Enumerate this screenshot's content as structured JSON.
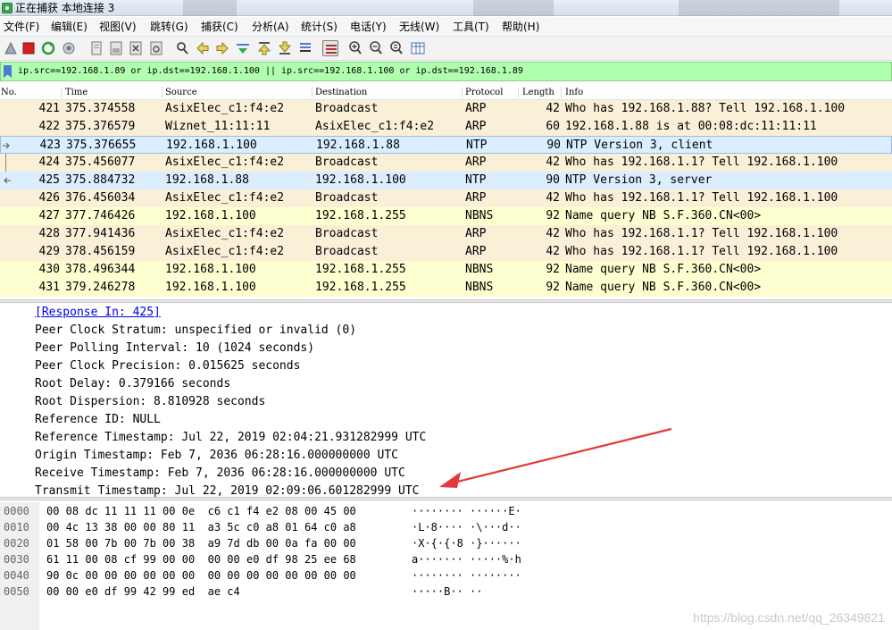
{
  "window": {
    "title": "正在捕获 本地连接 3"
  },
  "menu": [
    "文件(F)",
    "编辑(E)",
    "视图(V)",
    "跳转(G)",
    "捕获(C)",
    "分析(A)",
    "统计(S)",
    "电话(Y)",
    "无线(W)",
    "工具(T)",
    "帮助(H)"
  ],
  "toolbar": {
    "icons": [
      "shark-fin-icon",
      "stop-capture-icon",
      "restart-capture-icon",
      "capture-options-icon",
      "open-file-icon",
      "save-file-icon",
      "close-file-icon",
      "reload-file-icon",
      "find-packet-icon",
      "go-back-icon",
      "go-forward-icon",
      "go-to-packet-icon",
      "go-first-icon",
      "go-last-icon",
      "auto-scroll-icon",
      "colorize-icon",
      "zoom-in-icon",
      "zoom-out-icon",
      "zoom-normal-icon",
      "resize-columns-icon"
    ]
  },
  "filter": {
    "text": "ip.src==192.168.1.89 or ip.dst==192.168.1.100 || ip.src==192.168.1.100 or ip.dst==192.168.1.89"
  },
  "packet_list": {
    "columns": [
      "No.",
      "Time",
      "Source",
      "Destination",
      "Protocol",
      "Length",
      "Info"
    ],
    "rows": [
      {
        "no": "421",
        "time": "375.374558",
        "src": "AsixElec_c1:f4:e2",
        "dst": "Broadcast",
        "proto": "ARP",
        "len": "42",
        "info": "Who has 192.168.1.88? Tell 192.168.1.100"
      },
      {
        "no": "422",
        "time": "375.376579",
        "src": "Wiznet_11:11:11",
        "dst": "AsixElec_c1:f4:e2",
        "proto": "ARP",
        "len": "60",
        "info": "192.168.1.88 is at 00:08:dc:11:11:11"
      },
      {
        "no": "423",
        "time": "375.376655",
        "src": "192.168.1.100",
        "dst": "192.168.1.88",
        "proto": "NTP",
        "len": "90",
        "info": "NTP Version 3, client"
      },
      {
        "no": "424",
        "time": "375.456077",
        "src": "AsixElec_c1:f4:e2",
        "dst": "Broadcast",
        "proto": "ARP",
        "len": "42",
        "info": "Who has 192.168.1.1? Tell 192.168.1.100"
      },
      {
        "no": "425",
        "time": "375.884732",
        "src": "192.168.1.88",
        "dst": "192.168.1.100",
        "proto": "NTP",
        "len": "90",
        "info": "NTP Version 3, server"
      },
      {
        "no": "426",
        "time": "376.456034",
        "src": "AsixElec_c1:f4:e2",
        "dst": "Broadcast",
        "proto": "ARP",
        "len": "42",
        "info": "Who has 192.168.1.1? Tell 192.168.1.100"
      },
      {
        "no": "427",
        "time": "377.746426",
        "src": "192.168.1.100",
        "dst": "192.168.1.255",
        "proto": "NBNS",
        "len": "92",
        "info": "Name query NB S.F.360.CN<00>"
      },
      {
        "no": "428",
        "time": "377.941436",
        "src": "AsixElec_c1:f4:e2",
        "dst": "Broadcast",
        "proto": "ARP",
        "len": "42",
        "info": "Who has 192.168.1.1? Tell 192.168.1.100"
      },
      {
        "no": "429",
        "time": "378.456159",
        "src": "AsixElec_c1:f4:e2",
        "dst": "Broadcast",
        "proto": "ARP",
        "len": "42",
        "info": "Who has 192.168.1.1? Tell 192.168.1.100"
      },
      {
        "no": "430",
        "time": "378.496344",
        "src": "192.168.1.100",
        "dst": "192.168.1.255",
        "proto": "NBNS",
        "len": "92",
        "info": "Name query NB S.F.360.CN<00>"
      },
      {
        "no": "431",
        "time": "379.246278",
        "src": "192.168.1.100",
        "dst": "192.168.1.255",
        "proto": "NBNS",
        "len": "92",
        "info": "Name query NB S.F.360.CN<00>"
      }
    ]
  },
  "details": {
    "lines": [
      "[Response In: 425]",
      "Peer Clock Stratum: unspecified or invalid (0)",
      "Peer Polling Interval: 10 (1024 seconds)",
      "Peer Clock Precision: 0.015625 seconds",
      "Root Delay: 0.379166 seconds",
      "Root Dispersion: 8.810928 seconds",
      "Reference ID: NULL",
      "Reference Timestamp: Jul 22, 2019 02:04:21.931282999 UTC",
      "Origin Timestamp: Feb  7, 2036 06:28:16.000000000 UTC",
      "Receive Timestamp: Feb  7, 2036 06:28:16.000000000 UTC",
      "Transmit Timestamp: Jul 22, 2019 02:09:06.601282999 UTC"
    ]
  },
  "bytes": {
    "rows": [
      {
        "off": "0000",
        "hex": "00 08 dc 11 11 11 00 0e  c6 c1 f4 e2 08 00 45 00",
        "ascii": "········ ······E·"
      },
      {
        "off": "0010",
        "hex": "00 4c 13 38 00 00 80 11  a3 5c c0 a8 01 64 c0 a8",
        "ascii": "·L·8···· ·\\···d··"
      },
      {
        "off": "0020",
        "hex": "01 58 00 7b 00 7b 00 38  a9 7d db 00 0a fa 00 00",
        "ascii": "·X·{·{·8 ·}······"
      },
      {
        "off": "0030",
        "hex": "61 11 00 08 cf 99 00 00  00 00 e0 df 98 25 ee 68",
        "ascii": "a······· ·····%·h"
      },
      {
        "off": "0040",
        "hex": "90 0c 00 00 00 00 00 00  00 00 00 00 00 00 00 00",
        "ascii": "········ ········"
      },
      {
        "off": "0050",
        "hex": "00 00 e0 df 99 42 99 ed  ae c4",
        "ascii": "·····B·· ··"
      }
    ]
  },
  "watermark": "https://blog.csdn.net/qq_26349821"
}
